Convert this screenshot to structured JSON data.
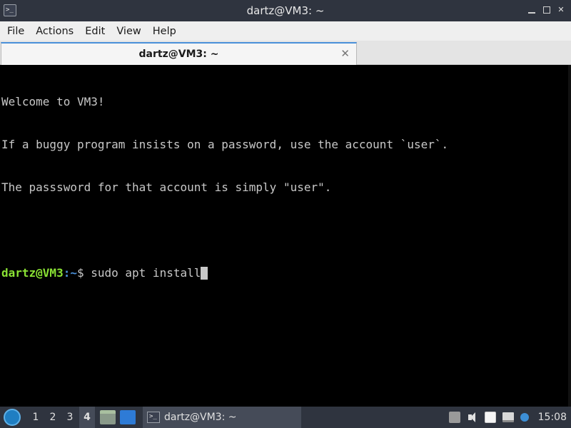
{
  "window": {
    "title": "dartz@VM3: ~",
    "app_icon_text": ">_"
  },
  "menu": [
    "File",
    "Actions",
    "Edit",
    "View",
    "Help"
  ],
  "tab": {
    "label": "dartz@VM3: ~",
    "close_symbol": "✕"
  },
  "terminal": {
    "lines": [
      "Welcome to VM3!",
      "If a buggy program insists on a password, use the account `user`.",
      "The passsword for that account is simply \"user\".",
      ""
    ],
    "prompt_user": "dartz@VM3",
    "prompt_path": ":~",
    "prompt_symbol": "$ ",
    "command": "sudo apt install"
  },
  "taskbar": {
    "workspaces": [
      "1",
      "2",
      "3",
      "4"
    ],
    "active_workspace": "4",
    "task_label": "dartz@VM3: ~",
    "clock": "15:08"
  },
  "colors": {
    "titlebar_bg": "#2f343f",
    "prompt_user": "#8ae234",
    "prompt_path": "#4a90d9",
    "terminal_fg": "#c8c8c8",
    "terminal_bg": "#000000"
  }
}
